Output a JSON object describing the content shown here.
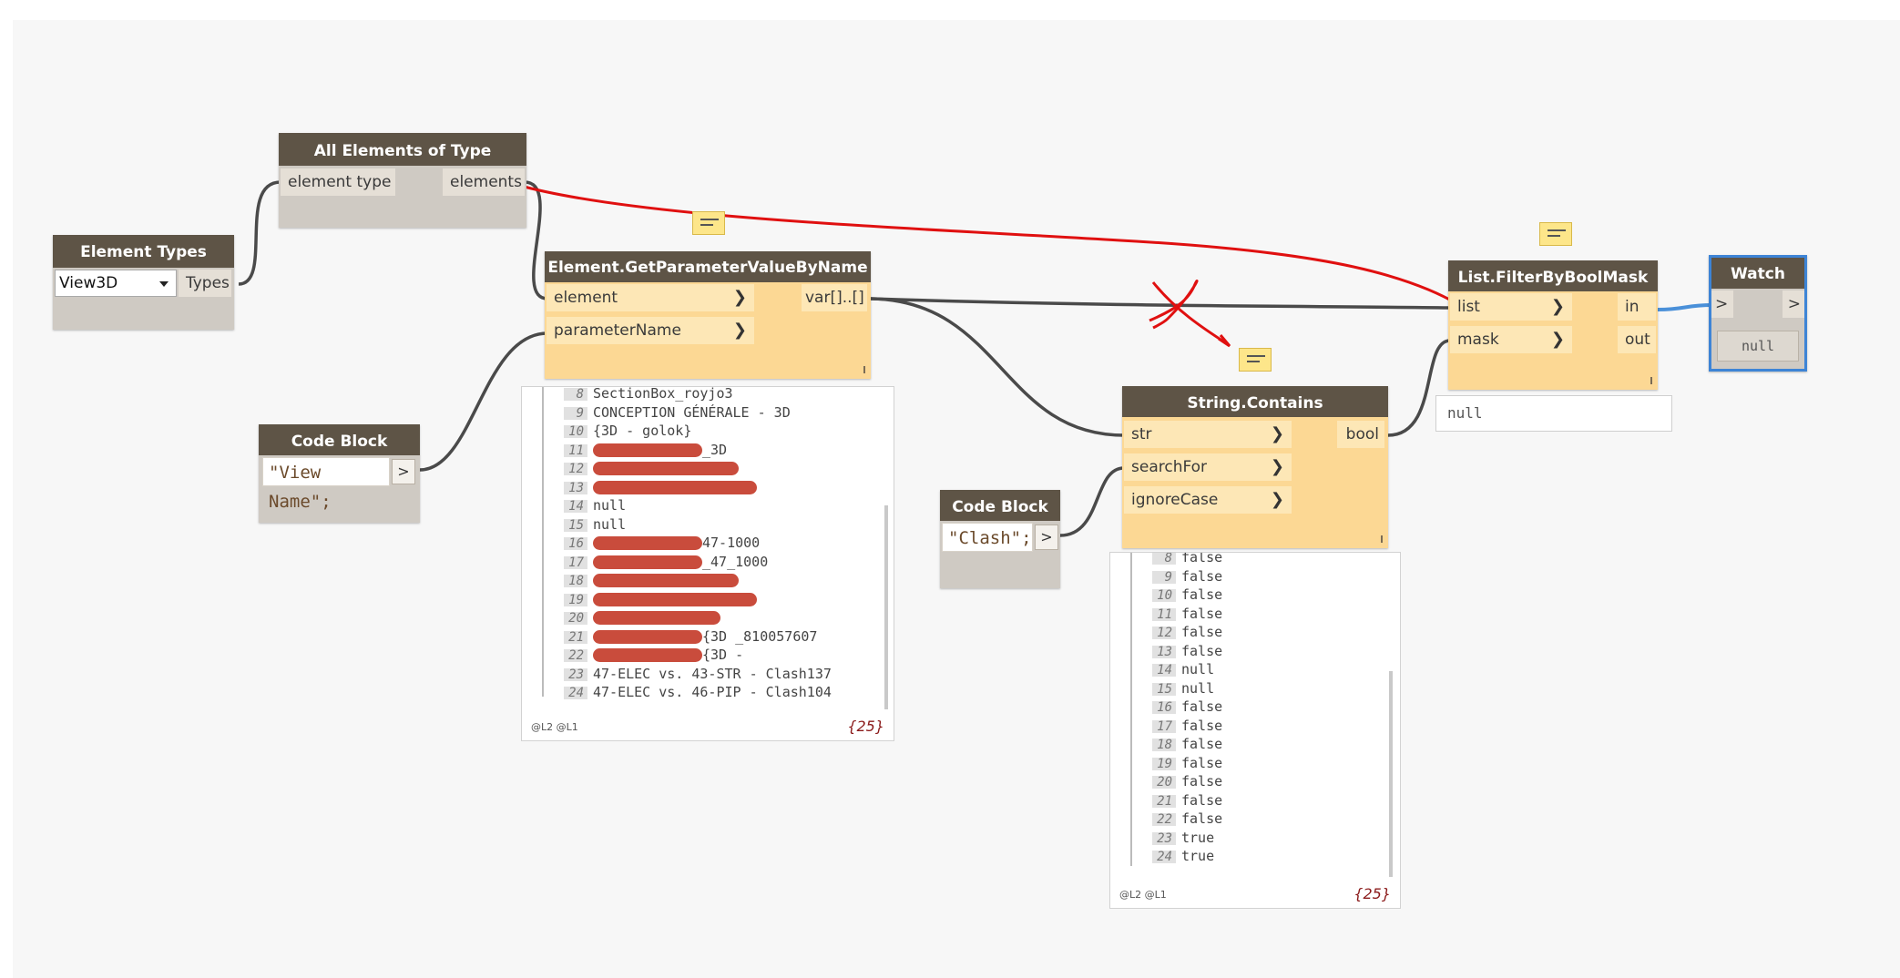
{
  "nodes": {
    "element_types": {
      "title": "Element Types",
      "dropdown_value": "View3D",
      "output": "Types"
    },
    "all_elements": {
      "title": "All Elements of Type",
      "input": "element type",
      "output": "elements"
    },
    "code_block_1": {
      "title": "Code Block",
      "code": "\"View Name\";",
      "port": ">"
    },
    "code_block_2": {
      "title": "Code Block",
      "code": "\"Clash\";",
      "port": ">"
    },
    "get_param": {
      "title": "Element.GetParameterValueByName",
      "inputs": [
        "element",
        "parameterName"
      ],
      "output": "var[]..[]"
    },
    "string_contains": {
      "title": "String.Contains",
      "inputs": [
        "str",
        "searchFor",
        "ignoreCase"
      ],
      "output": "bool"
    },
    "filter": {
      "title": "List.FilterByBoolMask",
      "inputs": [
        "list",
        "mask"
      ],
      "outputs": [
        "in",
        "out"
      ],
      "preview": "null"
    },
    "watch": {
      "title": "Watch",
      "in_port": ">",
      "out_port": ">",
      "value": "null"
    }
  },
  "preview_get_param": {
    "rows": [
      {
        "i": "8",
        "text": "SectionBox_royjo3",
        "redact": 0
      },
      {
        "i": "9",
        "text": "CONCEPTION GÉNÉRALE - 3D",
        "redact": 0
      },
      {
        "i": "10",
        "text": "{3D - golok}",
        "redact": 0
      },
      {
        "i": "11",
        "text": "_3D",
        "redact": 1
      },
      {
        "i": "12",
        "text": "",
        "redact": 1
      },
      {
        "i": "13",
        "text": "",
        "redact": 1
      },
      {
        "i": "14",
        "text": "null",
        "redact": 0
      },
      {
        "i": "15",
        "text": "null",
        "redact": 0
      },
      {
        "i": "16",
        "text": "47-1000",
        "redact": 1
      },
      {
        "i": "17",
        "text": "_47_1000",
        "redact": 1
      },
      {
        "i": "18",
        "text": "",
        "redact": 1
      },
      {
        "i": "19",
        "text": "",
        "redact": 1
      },
      {
        "i": "20",
        "text": "",
        "redact": 1
      },
      {
        "i": "21",
        "text": "{3D _810057607",
        "redact": 1
      },
      {
        "i": "22",
        "text": "{3D -",
        "redact": 1
      },
      {
        "i": "23",
        "text": "47-ELEC vs. 43-STR - Clash137",
        "redact": 0
      },
      {
        "i": "24",
        "text": "47-ELEC vs. 46-PIP - Clash104",
        "redact": 0
      }
    ],
    "levels": "@L2 @L1",
    "count": "{25}"
  },
  "preview_contains": {
    "rows": [
      {
        "i": "8",
        "text": "false"
      },
      {
        "i": "9",
        "text": "false"
      },
      {
        "i": "10",
        "text": "false"
      },
      {
        "i": "11",
        "text": "false"
      },
      {
        "i": "12",
        "text": "false"
      },
      {
        "i": "13",
        "text": "false"
      },
      {
        "i": "14",
        "text": "null"
      },
      {
        "i": "15",
        "text": "null"
      },
      {
        "i": "16",
        "text": "false"
      },
      {
        "i": "17",
        "text": "false"
      },
      {
        "i": "18",
        "text": "false"
      },
      {
        "i": "19",
        "text": "false"
      },
      {
        "i": "20",
        "text": "false"
      },
      {
        "i": "21",
        "text": "false"
      },
      {
        "i": "22",
        "text": "false"
      },
      {
        "i": "23",
        "text": "true"
      },
      {
        "i": "24",
        "text": "true"
      }
    ],
    "levels": "@L2 @L1",
    "count": "{25}"
  },
  "colors": {
    "node_header": "#5e5446",
    "node_body": "#cfcac3",
    "node_selected": "#fcd894",
    "wire": "#4a4a4a",
    "wire_watch": "#4a90d9",
    "annotation_red": "#e01010",
    "redaction": "#c94c3c"
  }
}
